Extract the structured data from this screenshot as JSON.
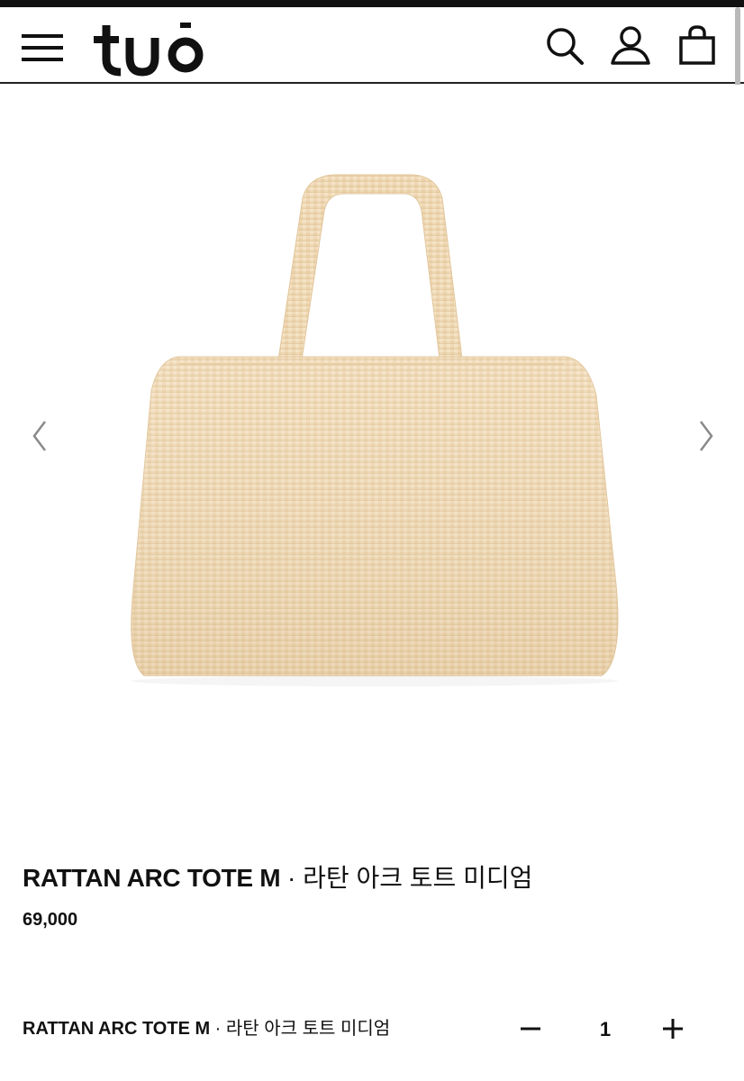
{
  "brand": {
    "logo_text": "tuō"
  },
  "header": {
    "menu_icon": "hamburger-menu-icon",
    "search_icon": "search-icon",
    "account_icon": "user-icon",
    "cart_icon": "shopping-bag-icon"
  },
  "gallery": {
    "image_subject": "rattan tote bag",
    "prev_icon": "chevron-left-icon",
    "next_icon": "chevron-right-icon",
    "bag_color": "#efd9b6"
  },
  "product": {
    "name_en": "RATTAN ARC TOTE M",
    "separator": " · ",
    "name_ko": "라탄 아크 토트 미디엄",
    "price": "69,000"
  },
  "option": {
    "name_en": "RATTAN ARC TOTE M",
    "separator": " · ",
    "name_ko": "라탄 아크 토트 미디엄",
    "minus": "−",
    "quantity": "1",
    "plus": "+"
  }
}
